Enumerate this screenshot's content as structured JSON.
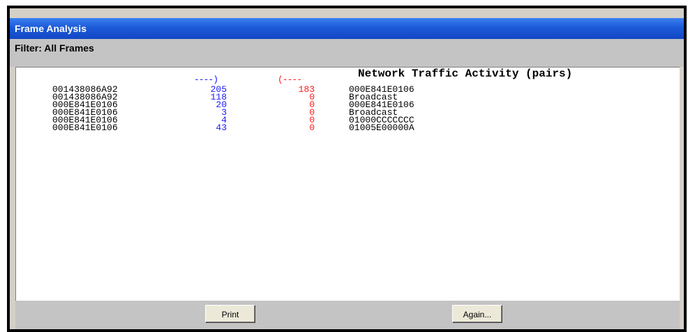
{
  "window": {
    "title": "Frame Analysis"
  },
  "filter": {
    "label": "Filter: All Frames"
  },
  "report": {
    "title": "Network Traffic Activity (pairs)",
    "forward_arrow": "----)",
    "reverse_arrow": "(----",
    "rows": [
      {
        "source": "001438086A92",
        "outbound": "205",
        "inbound": "183",
        "destination": "000E841E0106"
      },
      {
        "source": "001438086A92",
        "outbound": "118",
        "inbound": "0",
        "destination": "Broadcast"
      },
      {
        "source": "000E841E0106",
        "outbound": "20",
        "inbound": "0",
        "destination": "000E841E0106"
      },
      {
        "source": "000E841E0106",
        "outbound": "3",
        "inbound": "0",
        "destination": "Broadcast"
      },
      {
        "source": "000E841E0106",
        "outbound": "4",
        "inbound": "0",
        "destination": "01000CCCCCCC"
      },
      {
        "source": "000E841E0106",
        "outbound": "43",
        "inbound": "0",
        "destination": "01005E00000A"
      }
    ]
  },
  "buttons": {
    "print_label": "Print",
    "again_label": "Again..."
  },
  "colors": {
    "title_bar": "#1c5ad8",
    "outbound_text": "#1a1aff",
    "inbound_text": "#ff1a1a",
    "panel_gray": "#c4c4c4"
  }
}
